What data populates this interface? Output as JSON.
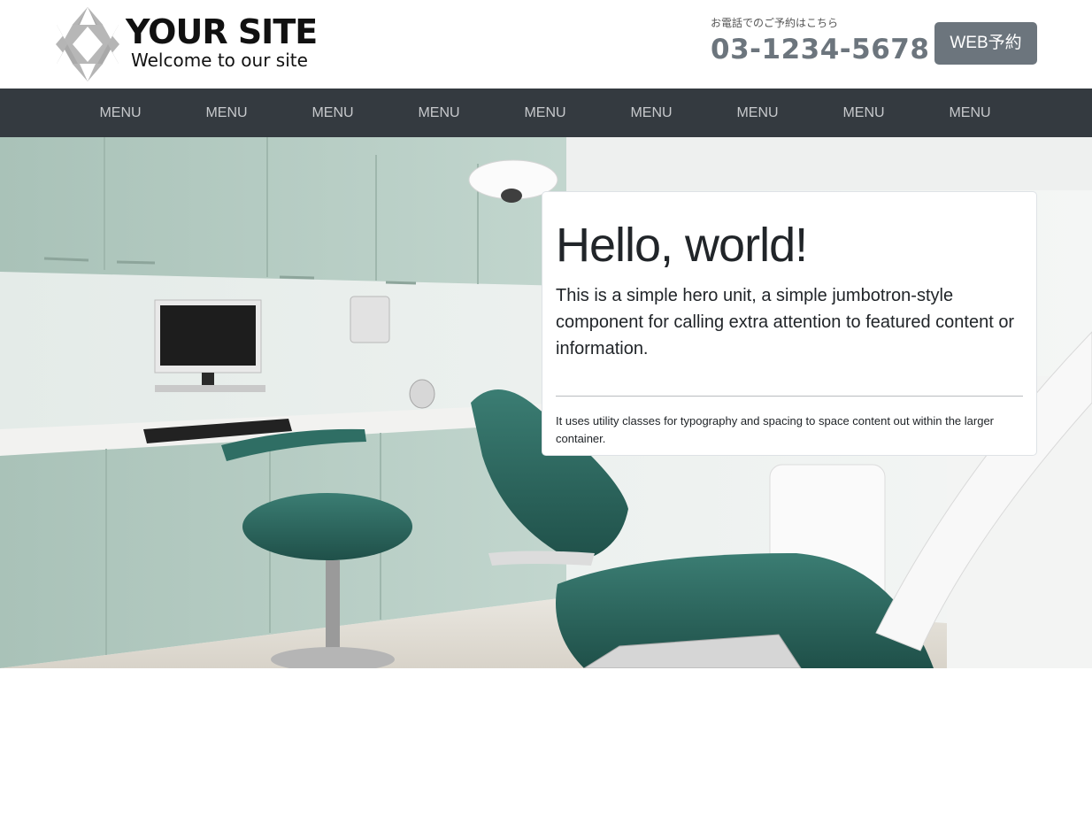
{
  "brand": {
    "title": "YOUR SITE",
    "tagline": "Welcome to our site"
  },
  "contact": {
    "label": "お電話でのご予約はこちら",
    "phone": "03-1234-5678"
  },
  "cta": {
    "label": "WEB予約"
  },
  "nav": {
    "items": [
      "MENU",
      "MENU",
      "MENU",
      "MENU",
      "MENU",
      "MENU",
      "MENU",
      "MENU",
      "MENU"
    ]
  },
  "hero": {
    "title": "Hello, world!",
    "lead": "This is a simple hero unit, a simple jumbotron-style component for calling extra attention to featured content or information.",
    "note": "It uses utility classes for typography and spacing to space content out within the larger container."
  },
  "colors": {
    "nav_bg": "#343a40",
    "button_bg": "#6c757d",
    "phone": "#6c757d",
    "cabinet": "#b9d0c7",
    "chair": "#2e6b62"
  }
}
